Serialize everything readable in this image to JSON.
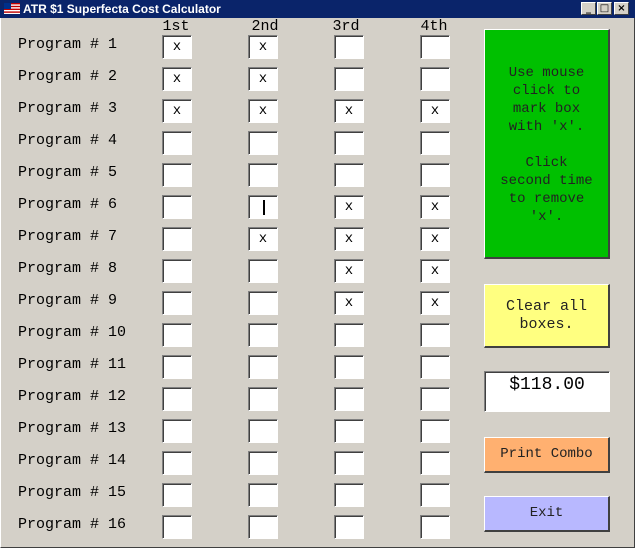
{
  "window": {
    "title": "ATR $1 Superfecta Cost Calculator",
    "minimize_label": "_",
    "maximize_label": "□",
    "close_label": "×"
  },
  "columns": [
    "1st",
    "2nd",
    "3rd",
    "4th"
  ],
  "rows": [
    {
      "label": "Program # 1",
      "marks": [
        "x",
        "x",
        "",
        ""
      ]
    },
    {
      "label": "Program # 2",
      "marks": [
        "x",
        "x",
        "",
        ""
      ]
    },
    {
      "label": "Program # 3",
      "marks": [
        "x",
        "x",
        "x",
        "x"
      ]
    },
    {
      "label": "Program # 4",
      "marks": [
        "",
        "",
        "",
        ""
      ]
    },
    {
      "label": "Program # 5",
      "marks": [
        "",
        "",
        "",
        ""
      ]
    },
    {
      "label": "Program # 6",
      "marks": [
        "",
        "",
        "x",
        "x"
      ]
    },
    {
      "label": "Program # 7",
      "marks": [
        "",
        "x",
        "x",
        "x"
      ]
    },
    {
      "label": "Program # 8",
      "marks": [
        "",
        "",
        "x",
        "x"
      ]
    },
    {
      "label": "Program # 9",
      "marks": [
        "",
        "",
        "x",
        "x"
      ]
    },
    {
      "label": "Program # 10",
      "marks": [
        "",
        "",
        "",
        ""
      ]
    },
    {
      "label": "Program # 11",
      "marks": [
        "",
        "",
        "",
        ""
      ]
    },
    {
      "label": "Program # 12",
      "marks": [
        "",
        "",
        "",
        ""
      ]
    },
    {
      "label": "Program # 13",
      "marks": [
        "",
        "",
        "",
        ""
      ]
    },
    {
      "label": "Program # 14",
      "marks": [
        "",
        "",
        "",
        ""
      ]
    },
    {
      "label": "Program # 15",
      "marks": [
        "",
        "",
        "",
        ""
      ]
    },
    {
      "label": "Program # 16",
      "marks": [
        "",
        "",
        "",
        ""
      ]
    }
  ],
  "focused_cell": {
    "row": 6,
    "column": "2nd"
  },
  "instructions": "Use mouse\nclick to\nmark box\nwith 'x'.\n\nClick\nsecond time\nto remove\n'x'.",
  "clear_button": "Clear all\nboxes.",
  "total": "$118.00",
  "print_button": "Print Combo",
  "exit_button": "Exit",
  "colors": {
    "window_bg": "#d4d0c8",
    "titlebar": "#0a246a",
    "instructions_bg": "#00c000",
    "clear_bg": "#ffff80",
    "print_bg": "#ffb070",
    "exit_bg": "#b8b8ff"
  },
  "icons": {
    "title": "us-flag-icon"
  }
}
